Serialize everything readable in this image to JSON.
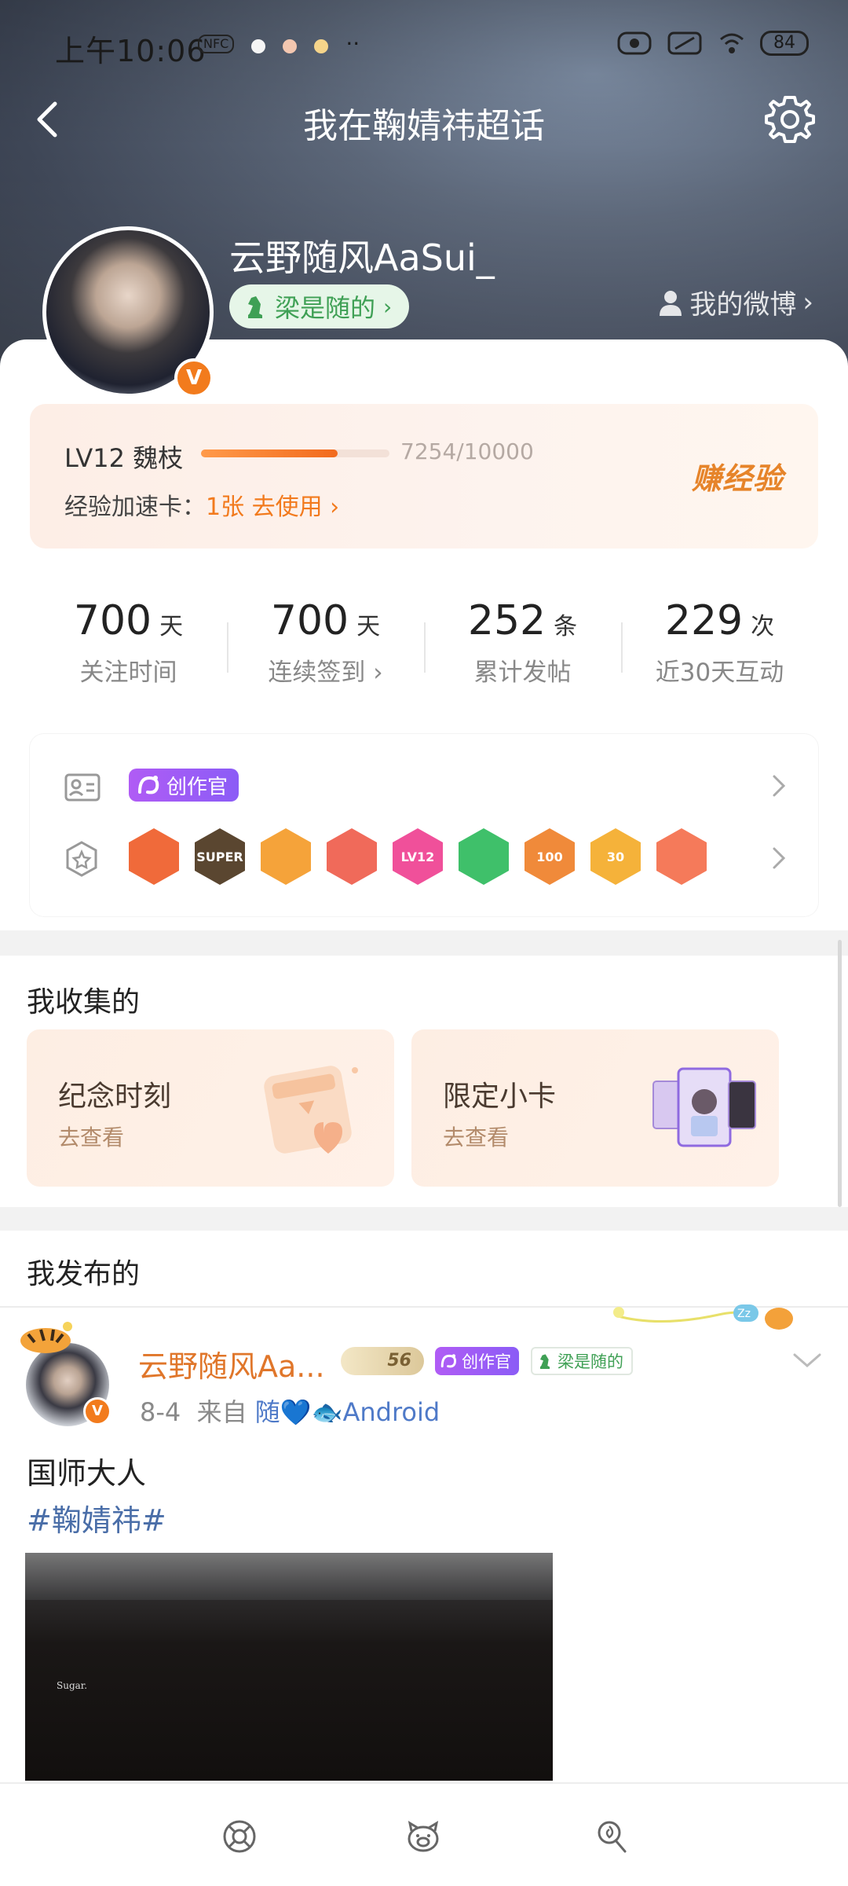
{
  "status_bar": {
    "time": "上午10:06",
    "nfc": "NFC",
    "battery": "84"
  },
  "nav": {
    "title": "我在鞠婧祎超话"
  },
  "profile": {
    "username": "云野随风AaSui_",
    "tag": "梁是随的",
    "my_weibo": "我的微博"
  },
  "experience": {
    "level": "LV12 魏枝",
    "progress": 0.7254,
    "count": "7254/10000",
    "speed_label": "经验加速卡：",
    "speed_value": "1张 去使用",
    "earn": "赚经验"
  },
  "stats": [
    {
      "value": "700",
      "unit": "天",
      "label": "关注时间"
    },
    {
      "value": "700",
      "unit": "天",
      "label": "连续签到 ›"
    },
    {
      "value": "252",
      "unit": "条",
      "label": "累计发帖"
    },
    {
      "value": "229",
      "unit": "次",
      "label": "近30天互动"
    }
  ],
  "badges": {
    "creator_tag": "创作官",
    "medals": [
      {
        "label": "",
        "color": "#f06a3a"
      },
      {
        "label": "SUPER",
        "color": "#5a4630"
      },
      {
        "label": "",
        "color": "#f5a33a"
      },
      {
        "label": "",
        "color": "#f06a5a"
      },
      {
        "label": "LV12",
        "color": "#f0509a"
      },
      {
        "label": "",
        "color": "#3fc06a"
      },
      {
        "label": "100",
        "color": "#f08a3a"
      },
      {
        "label": "30",
        "color": "#f5b23a"
      },
      {
        "label": "",
        "color": "#f57a5a"
      }
    ]
  },
  "collect": {
    "title": "我收集的",
    "cards": [
      {
        "title": "纪念时刻",
        "sub": "去查看"
      },
      {
        "title": "限定小卡",
        "sub": "去查看"
      }
    ]
  },
  "published": {
    "title": "我发布的",
    "post": {
      "name": "云野随风Aa...",
      "level": "56",
      "creator_tag": "创作官",
      "horse_tag": "梁是随的",
      "date": "8-4",
      "from": "来自",
      "source": "随💙🐟Android",
      "text": "国师大人",
      "hashtag": "#鞠婧祎#",
      "image_caption": "Sugar."
    }
  },
  "colors": {
    "accent": "#f27a1d",
    "creator": "#a05cf5",
    "green": "#3fa055",
    "link": "#4a6ea8"
  }
}
